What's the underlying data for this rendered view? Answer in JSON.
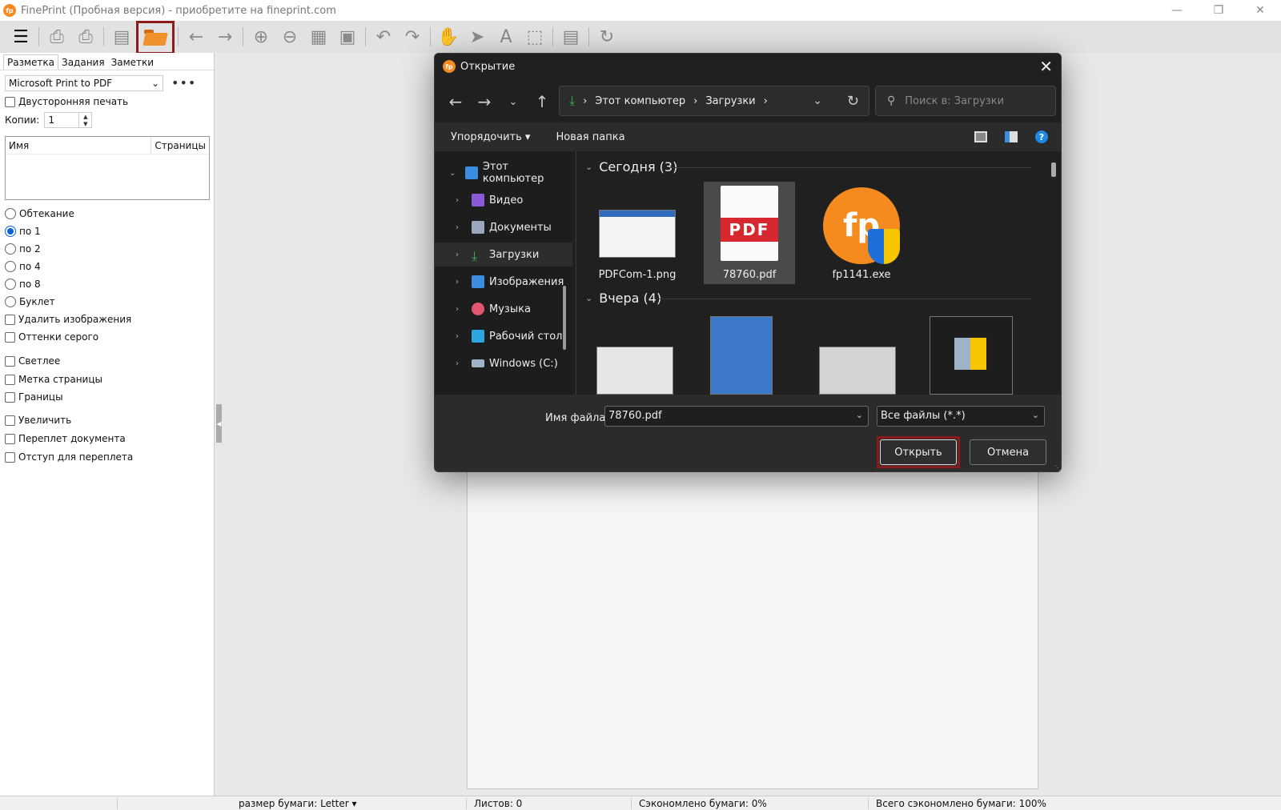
{
  "window": {
    "title": "FinePrint (Пробная версия) - приобретите на fineprint.com",
    "logo": "fp",
    "controls": [
      "minimize-icon",
      "restore-icon",
      "close-icon"
    ]
  },
  "toolbar": {
    "items": [
      "menu-icon",
      "print-icon",
      "print-setup-icon",
      "save-icon",
      "open-folder-icon",
      "back-arrow-icon",
      "forward-arrow-icon",
      "zoom-in-icon",
      "zoom-out-icon",
      "grid-icon",
      "fit-icon",
      "undo-icon",
      "redo-icon",
      "hand-icon",
      "pointer-icon",
      "text-icon",
      "select-icon",
      "document-icon",
      "refresh-icon"
    ],
    "highlight_color": "#8b1a1a"
  },
  "left_panel": {
    "tabs": [
      "Разметка",
      "Задания",
      "Заметки"
    ],
    "printer": "Microsoft Print to PDF",
    "more": "•••",
    "duplex_label": "Двусторонняя печать",
    "copies_label": "Копии:",
    "copies_value": "1",
    "jobs_columns": [
      "Имя",
      "Страницы"
    ],
    "layout_options": [
      {
        "label": "Обтекание",
        "checked": false
      },
      {
        "label": "по 1",
        "checked": true
      },
      {
        "label": "по 2",
        "checked": false
      },
      {
        "label": "по 4",
        "checked": false
      },
      {
        "label": "по 8",
        "checked": false
      },
      {
        "label": "Буклет",
        "checked": false
      }
    ],
    "checkboxes": [
      "Удалить изображения",
      "Оттенки серого",
      "Светлее",
      "Метка страницы",
      "Границы",
      "Увеличить",
      "Переплет документа",
      "Отступ для переплета"
    ]
  },
  "statusbar": {
    "paper_size": "размер бумаги: Letter",
    "sheets": "Листов: 0",
    "saved": "Сэкономлено бумаги: 0%",
    "total_saved": "Всего сэкономлено бумаги: 100%"
  },
  "dialog": {
    "title": "Открытие",
    "logo": "fp",
    "breadcrumb": [
      "Этот компьютер",
      "Загрузки"
    ],
    "search_placeholder": "Поиск в: Загрузки",
    "organize": "Упорядочить",
    "new_folder": "Новая папка",
    "help": "?",
    "nav_items": [
      {
        "label": "Этот компьютер",
        "expanded": true,
        "icon": "computer-icon",
        "color": "#3b8de0"
      },
      {
        "label": "Видео",
        "icon": "video-icon",
        "color": "#8a5ad8"
      },
      {
        "label": "Документы",
        "icon": "documents-icon",
        "color": "#9aa7bf"
      },
      {
        "label": "Загрузки",
        "icon": "downloads-icon",
        "color": "#3bb54a",
        "selected": true
      },
      {
        "label": "Изображения",
        "icon": "pictures-icon",
        "color": "#3b8de0"
      },
      {
        "label": "Музыка",
        "icon": "music-icon",
        "color": "#e2566f"
      },
      {
        "label": "Рабочий стол",
        "icon": "desktop-icon",
        "color": "#2aa7e0"
      },
      {
        "label": "Windows (C:)",
        "icon": "drive-icon",
        "color": "#9fb3c8"
      }
    ],
    "groups": [
      {
        "label": "Сегодня (3)",
        "files": [
          {
            "name": "PDFCom-1.png",
            "type": "image"
          },
          {
            "name": "78760.pdf",
            "type": "pdf",
            "selected": true
          },
          {
            "name": "fp1141.exe",
            "type": "exe"
          }
        ]
      },
      {
        "label": "Вчера (4)",
        "files": [
          {
            "type": "image"
          },
          {
            "type": "installer"
          },
          {
            "type": "image"
          },
          {
            "type": "setup"
          }
        ]
      }
    ],
    "pdf_badge": "PDF",
    "fp_badge": "fp",
    "filename_label": "Имя файла:",
    "filename_value": "78760.pdf",
    "filter_value": "Все файлы (*.*)",
    "open_button": "Открыть",
    "cancel_button": "Отмена"
  }
}
